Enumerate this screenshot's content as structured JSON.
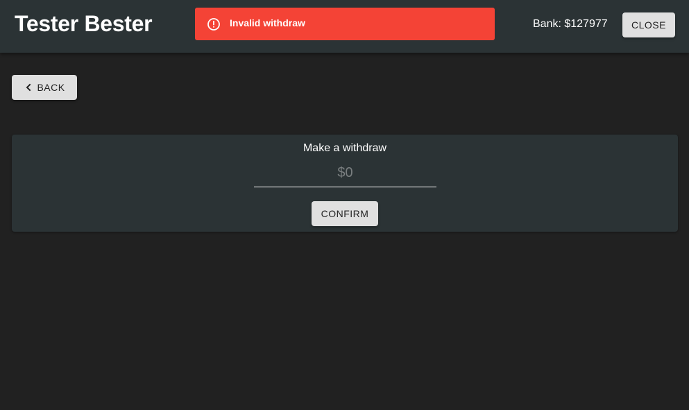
{
  "header": {
    "title": "Tester Bester",
    "bank_text": "Bank: $127977",
    "close_label": "CLOSE"
  },
  "alert": {
    "message": "Invalid withdraw",
    "icon": "alert-circle-icon",
    "color": "#f44336"
  },
  "nav": {
    "back_label": "BACK",
    "back_icon": "chevron-left-icon"
  },
  "withdraw": {
    "title": "Make a withdraw",
    "amount_value": "",
    "amount_placeholder": "$0",
    "confirm_label": "CONFIRM"
  },
  "colors": {
    "background": "#212121",
    "header": "#2b3335",
    "card": "#2b3335",
    "button": "#e0e0e0"
  }
}
